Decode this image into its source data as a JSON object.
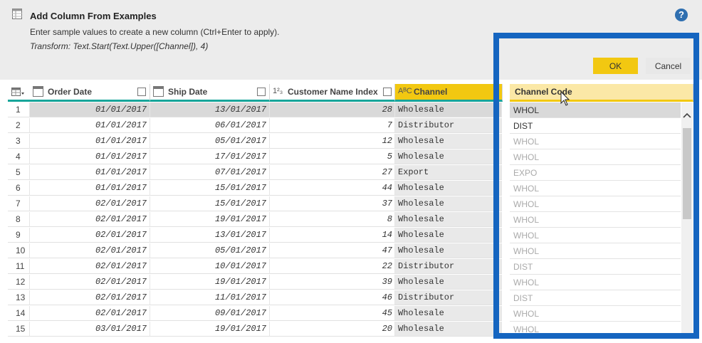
{
  "panel": {
    "title": "Add Column From Examples",
    "description": "Enter sample values to create a new column (Ctrl+Enter to apply).",
    "transform": "Transform: Text.Start(Text.Upper([Channel]), 4)",
    "help_glyph": "?"
  },
  "buttons": {
    "ok": "OK",
    "cancel": "Cancel"
  },
  "columns": {
    "order_date": "Order Date",
    "ship_date": "Ship Date",
    "customer_index": "Customer Name Index",
    "customer_index_type": "1²₃",
    "channel": "Channel",
    "channel_type": "AᴮC",
    "channel_code": "Channel Code"
  },
  "rows": [
    {
      "idx": "1",
      "order": "01/01/2017",
      "ship": "13/01/2017",
      "cust": "28",
      "channel": "Wholesale"
    },
    {
      "idx": "2",
      "order": "01/01/2017",
      "ship": "06/01/2017",
      "cust": "7",
      "channel": "Distributor"
    },
    {
      "idx": "3",
      "order": "01/01/2017",
      "ship": "05/01/2017",
      "cust": "12",
      "channel": "Wholesale"
    },
    {
      "idx": "4",
      "order": "01/01/2017",
      "ship": "17/01/2017",
      "cust": "5",
      "channel": "Wholesale"
    },
    {
      "idx": "5",
      "order": "01/01/2017",
      "ship": "07/01/2017",
      "cust": "27",
      "channel": "Export"
    },
    {
      "idx": "6",
      "order": "01/01/2017",
      "ship": "15/01/2017",
      "cust": "44",
      "channel": "Wholesale"
    },
    {
      "idx": "7",
      "order": "02/01/2017",
      "ship": "15/01/2017",
      "cust": "37",
      "channel": "Wholesale"
    },
    {
      "idx": "8",
      "order": "02/01/2017",
      "ship": "19/01/2017",
      "cust": "8",
      "channel": "Wholesale"
    },
    {
      "idx": "9",
      "order": "02/01/2017",
      "ship": "13/01/2017",
      "cust": "14",
      "channel": "Wholesale"
    },
    {
      "idx": "10",
      "order": "02/01/2017",
      "ship": "05/01/2017",
      "cust": "47",
      "channel": "Wholesale"
    },
    {
      "idx": "11",
      "order": "02/01/2017",
      "ship": "10/01/2017",
      "cust": "22",
      "channel": "Distributor"
    },
    {
      "idx": "12",
      "order": "02/01/2017",
      "ship": "19/01/2017",
      "cust": "39",
      "channel": "Wholesale"
    },
    {
      "idx": "13",
      "order": "02/01/2017",
      "ship": "11/01/2017",
      "cust": "46",
      "channel": "Distributor"
    },
    {
      "idx": "14",
      "order": "02/01/2017",
      "ship": "09/01/2017",
      "cust": "45",
      "channel": "Wholesale"
    },
    {
      "idx": "15",
      "order": "03/01/2017",
      "ship": "19/01/2017",
      "cust": "20",
      "channel": "Wholesale"
    }
  ],
  "examples": [
    "WHOL",
    "DIST",
    "WHOL",
    "WHOL",
    "EXPO",
    "WHOL",
    "WHOL",
    "WHOL",
    "WHOL",
    "WHOL",
    "DIST",
    "WHOL",
    "DIST",
    "WHOL",
    "WHOL"
  ],
  "colors": {
    "accent": "#f2c811",
    "teal": "#17a59a",
    "highlight": "#1565c0"
  }
}
